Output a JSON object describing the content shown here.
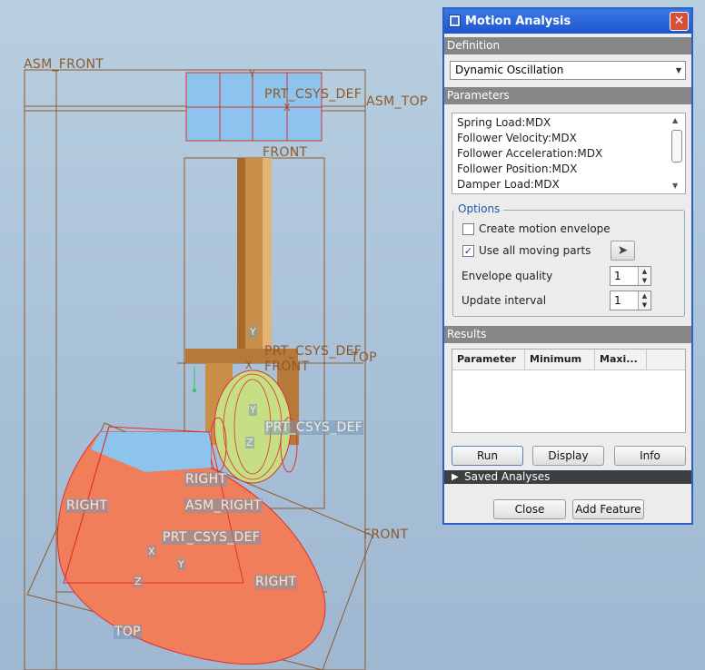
{
  "viewport": {
    "labels": {
      "asm_front": "ASM_FRONT",
      "prt_csys_def_top": "PRT_CSYS_DEF",
      "asm_top": "ASM_TOP",
      "front_top": "FRONT",
      "prt_csys_def_mid": "PRT_CSYS_DEF",
      "top_mid": "TOP",
      "front_mid": "FRONT",
      "prt_csys_def_low": "PRT_CSYS_DEF",
      "right_a": "RIGHT",
      "right_b": "RIGHT",
      "asm_right": "ASM_RIGHT",
      "prt_csys_def_cam": "PRT_CSYS_DEF",
      "front_right": "FRONT",
      "right_c": "RIGHT",
      "top_bottom": "TOP",
      "y_top": "Y",
      "x_top": "X",
      "y_mid": "Y",
      "x_mid": "X",
      "y_low": "Y",
      "z_low": "Z",
      "x_cam": "X",
      "y_cam": "Y",
      "z_cam": "Z"
    },
    "colors": {
      "background": "#a9c1d8",
      "datum_line": "#8e5a2c",
      "cam": "#f07e5a",
      "follower": "#c98f4a",
      "roller": "#c6df84",
      "highlight_red": "#e03030"
    }
  },
  "dialog": {
    "title": "Motion Analysis",
    "close_glyph": "✕",
    "definition_header": "Definition",
    "definition_value": "Dynamic Oscillation",
    "parameters_header": "Parameters",
    "parameters": [
      "Spring Load:MDX",
      "Follower Velocity:MDX",
      "Follower Acceleration:MDX",
      "Follower Position:MDX",
      "Damper Load:MDX"
    ],
    "options": {
      "title": "Options",
      "create_envelope": {
        "label": "Create motion envelope",
        "checked": false
      },
      "use_all_parts": {
        "label": "Use all moving parts",
        "checked": true
      },
      "envelope_quality": {
        "label": "Envelope quality",
        "value": "1"
      },
      "update_interval": {
        "label": "Update interval",
        "value": "1"
      }
    },
    "results_header": "Results",
    "results_columns": [
      "Parameter",
      "Minimum",
      "Maxi..."
    ],
    "buttons": {
      "run": "Run",
      "display": "Display",
      "info": "Info",
      "close": "Close",
      "add_feature": "Add Feature"
    },
    "saved_analyses": "Saved Analyses"
  }
}
